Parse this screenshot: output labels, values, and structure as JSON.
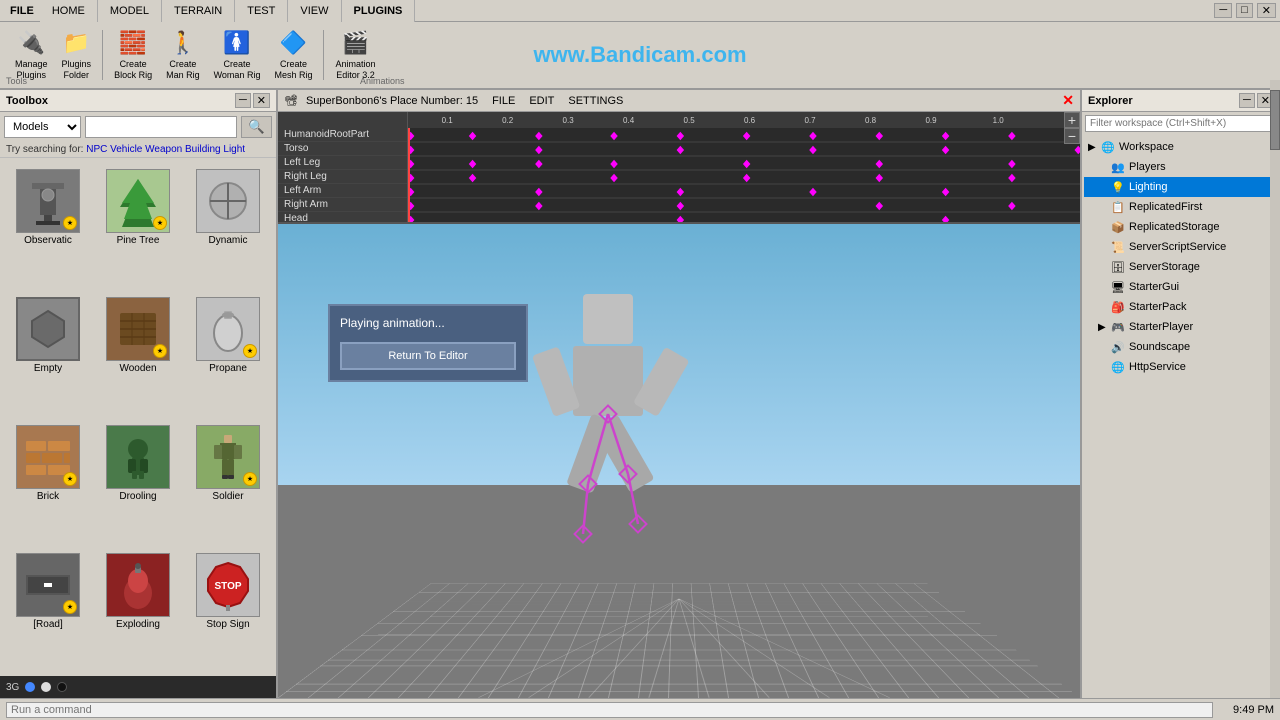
{
  "topbar": {
    "file_label": "FILE",
    "tabs": [
      "HOME",
      "MODEL",
      "TERRAIN",
      "TEST",
      "VIEW",
      "PLUGINS"
    ]
  },
  "toolbar": {
    "plugins_group": "Tools",
    "animations_group": "Animations",
    "items": [
      {
        "label": "Manage\nPlugins",
        "icon": "🔧"
      },
      {
        "label": "Plugins\nFolder",
        "icon": "📁"
      },
      {
        "label": "Create\nBlock Rig",
        "icon": "👤"
      },
      {
        "label": "Create\nMan Rig",
        "icon": "🚶"
      },
      {
        "label": "Create\nWoman Rig",
        "icon": "🚺"
      },
      {
        "label": "Create\nMesh Rig",
        "icon": "🔷"
      },
      {
        "label": "Animation\nEditor 3.2",
        "icon": "▶"
      }
    ],
    "watermark": "www.Bandicam.com"
  },
  "toolbox": {
    "title": "Toolbox",
    "search_placeholder": "",
    "model_option": "Models",
    "try_searching_prefix": "Try searching for: ",
    "suggestions": [
      "NPC",
      "Vehicle",
      "Weapon",
      "Building",
      "Light"
    ],
    "items": [
      {
        "label": "Observatic",
        "badge": true
      },
      {
        "label": "Pine Tree",
        "badge": true,
        "color": "#2d6b2d"
      },
      {
        "label": "Dynamic",
        "badge": false
      },
      {
        "label": "Empty",
        "badge": false
      },
      {
        "label": "Wooden",
        "badge": true,
        "color": "#6b3a1f"
      },
      {
        "label": "Propane",
        "badge": true
      },
      {
        "label": "Brick",
        "badge": true
      },
      {
        "label": "Drooling",
        "badge": false
      },
      {
        "label": "Soldier",
        "badge": true
      },
      {
        "label": "[Road]",
        "badge": true
      },
      {
        "label": "Exploding",
        "badge": false,
        "color": "#8b0000"
      },
      {
        "label": "Stop Sign",
        "badge": false
      }
    ]
  },
  "anim_editor": {
    "title": "SuperBonbon6's Place Number: 15",
    "menu": [
      "FILE",
      "EDIT",
      "SETTINGS"
    ],
    "bones": [
      "HumanoidRootPart",
      "Torso",
      "Left Leg",
      "Right Leg",
      "Left Arm",
      "Right Arm",
      "Head"
    ],
    "ruler_marks": [
      "0.1",
      "0.2",
      "0.3",
      "0.4",
      "0.5",
      "0.6",
      "0.7",
      "0.8",
      "0.9",
      "1.0"
    ]
  },
  "viewport": {
    "dialog": {
      "title": "Playing animation...",
      "button_label": "Return To Editor"
    }
  },
  "explorer": {
    "title": "Explorer",
    "search_placeholder": "Filter workspace (Ctrl+Shift+X)",
    "tree": [
      {
        "label": "Workspace",
        "indent": 0,
        "arrow": "▶",
        "icon": "🌐"
      },
      {
        "label": "Players",
        "indent": 1,
        "arrow": "",
        "icon": "👥"
      },
      {
        "label": "Lighting",
        "indent": 1,
        "arrow": "",
        "icon": "💡",
        "selected": true
      },
      {
        "label": "ReplicatedFirst",
        "indent": 1,
        "arrow": "",
        "icon": "📋"
      },
      {
        "label": "ReplicatedStorage",
        "indent": 1,
        "arrow": "",
        "icon": "📦"
      },
      {
        "label": "ServerScriptService",
        "indent": 1,
        "arrow": "",
        "icon": "📜"
      },
      {
        "label": "ServerStorage",
        "indent": 1,
        "arrow": "",
        "icon": "🗄"
      },
      {
        "label": "StarterGui",
        "indent": 1,
        "arrow": "",
        "icon": "🖥"
      },
      {
        "label": "StarterPack",
        "indent": 1,
        "arrow": "",
        "icon": "🎒"
      },
      {
        "label": "StarterPlayer",
        "indent": 1,
        "arrow": "▶",
        "icon": "🎮"
      },
      {
        "label": "Soundscape",
        "indent": 1,
        "arrow": "",
        "icon": "🔊"
      },
      {
        "label": "HttpService",
        "indent": 1,
        "arrow": "",
        "icon": "🌐"
      }
    ]
  },
  "bottom_bar": {
    "cmd_placeholder": "Run a command",
    "status_items": [
      "3G"
    ],
    "time": "9:49 PM"
  }
}
